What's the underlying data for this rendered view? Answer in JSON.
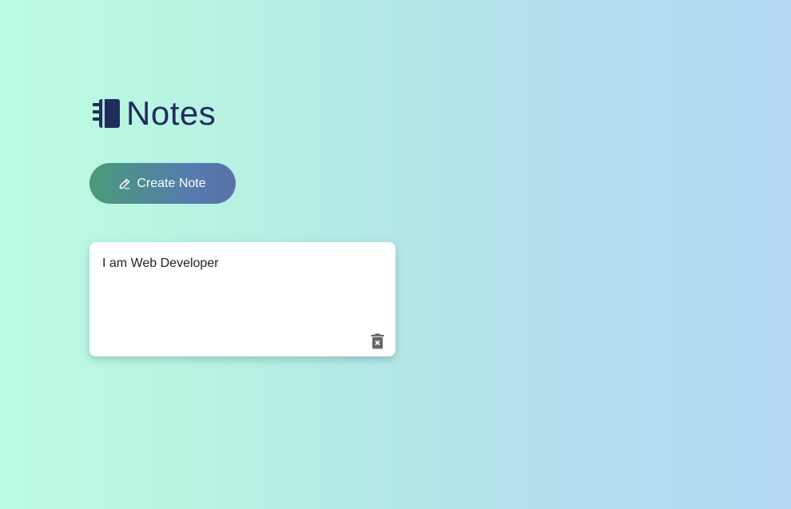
{
  "header": {
    "title": "Notes",
    "icon": "notebook-icon"
  },
  "toolbar": {
    "create_label": "Create Note",
    "create_icon": "pencil-icon"
  },
  "notes": [
    {
      "text": "I am Web Developer",
      "delete_icon": "trash-icon"
    }
  ],
  "colors": {
    "heading": "#1f2d5a",
    "button_gradient_start": "#4a9b78",
    "button_gradient_end": "#5872a8",
    "card": "#ffffff"
  }
}
